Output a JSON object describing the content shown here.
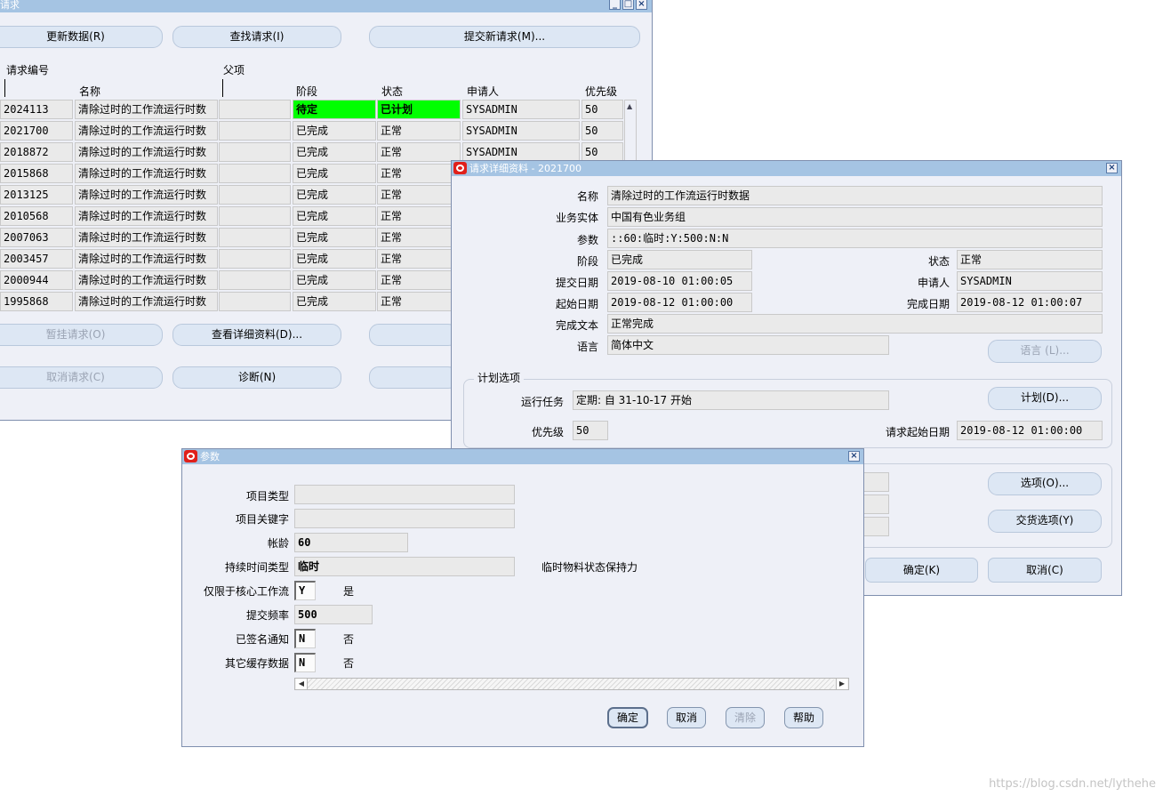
{
  "request_window": {
    "title": "请求",
    "buttons": {
      "refresh": "更新数据(R)",
      "find": "查找请求(I)",
      "submit_new": "提交新请求(M)...",
      "hold": "暂挂请求(O)",
      "view_details": "查看详细资料(D)...",
      "cancel_request": "取消请求(C)",
      "diagnose": "诊断(N)"
    },
    "headers": {
      "request_id": "请求编号",
      "parent": "父项",
      "name": "名称",
      "phase": "阶段",
      "status": "状态",
      "requestor": "申请人",
      "priority": "优先级"
    },
    "rows": [
      {
        "id": "2024113",
        "name": "清除过时的工作流运行时数",
        "phase": "待定",
        "status": "已计划",
        "requestor": "SYSADMIN",
        "priority": "50"
      },
      {
        "id": "2021700",
        "name": "清除过时的工作流运行时数",
        "phase": "已完成",
        "status": "正常",
        "requestor": "SYSADMIN",
        "priority": "50"
      },
      {
        "id": "2018872",
        "name": "清除过时的工作流运行时数",
        "phase": "已完成",
        "status": "正常",
        "requestor": "SYSADMIN",
        "priority": "50"
      },
      {
        "id": "2015868",
        "name": "清除过时的工作流运行时数",
        "phase": "已完成",
        "status": "正常",
        "requestor": "",
        "priority": ""
      },
      {
        "id": "2013125",
        "name": "清除过时的工作流运行时数",
        "phase": "已完成",
        "status": "正常",
        "requestor": "",
        "priority": ""
      },
      {
        "id": "2010568",
        "name": "清除过时的工作流运行时数",
        "phase": "已完成",
        "status": "正常",
        "requestor": "",
        "priority": ""
      },
      {
        "id": "2007063",
        "name": "清除过时的工作流运行时数",
        "phase": "已完成",
        "status": "正常",
        "requestor": "",
        "priority": ""
      },
      {
        "id": "2003457",
        "name": "清除过时的工作流运行时数",
        "phase": "已完成",
        "status": "正常",
        "requestor": "",
        "priority": ""
      },
      {
        "id": "2000944",
        "name": "清除过时的工作流运行时数",
        "phase": "已完成",
        "status": "正常",
        "requestor": "",
        "priority": ""
      },
      {
        "id": "1995868",
        "name": "清除过时的工作流运行时数",
        "phase": "已完成",
        "status": "正常",
        "requestor": "",
        "priority": ""
      }
    ]
  },
  "detail_window": {
    "title": "请求详细资料 - 2021700",
    "labels": {
      "name": "名称",
      "org": "业务实体",
      "params": "参数",
      "phase": "阶段",
      "status": "状态",
      "submit_date": "提交日期",
      "requestor": "申请人",
      "start_date": "起始日期",
      "complete_date": "完成日期",
      "completion_text": "完成文本",
      "language": "语言",
      "schedule_group": "计划选项",
      "run_job": "运行任务",
      "priority": "优先级",
      "req_start_date": "请求起始日期"
    },
    "values": {
      "name": "清除过时的工作流运行时数据",
      "org": "中国有色业务组",
      "params": "::60:临时:Y:500:N:N",
      "phase": "已完成",
      "status": "正常",
      "submit_date": "2019-08-10 01:00:05",
      "requestor": "SYSADMIN",
      "start_date": "2019-08-12 01:00:00",
      "complete_date": "2019-08-12 01:00:07",
      "completion_text": "正常完成",
      "language": "简体中文",
      "run_job": "定期: 自 31-10-17 开始",
      "priority": "50",
      "req_start_date": "2019-08-12 01:00:00"
    },
    "buttons": {
      "language": "语言 (L)...",
      "schedule": "计划(D)...",
      "options": "选项(O)...",
      "delivery": "交货选项(Y)",
      "ok": "确定(K)",
      "cancel": "取消(C)"
    }
  },
  "params_window": {
    "title": "参数",
    "fields": [
      {
        "label": "项目类型",
        "value": "",
        "desc": ""
      },
      {
        "label": "项目关键字",
        "value": "",
        "desc": ""
      },
      {
        "label": "帐龄",
        "value": "60",
        "desc": ""
      },
      {
        "label": "持续时间类型",
        "value": "临时",
        "desc": "临时物料状态保持力"
      },
      {
        "label": "仅限于核心工作流",
        "value": "Y",
        "desc": "是"
      },
      {
        "label": "提交频率",
        "value": "500",
        "desc": ""
      },
      {
        "label": "已签名通知",
        "value": "N",
        "desc": "否"
      },
      {
        "label": "其它缓存数据",
        "value": "N",
        "desc": "否"
      }
    ],
    "buttons": {
      "ok": "确定",
      "cancel": "取消",
      "clear": "清除",
      "help": "帮助"
    }
  },
  "watermark": "https://blog.csdn.net/lythehe",
  "colors": {
    "title_bar": "#a5c4e3",
    "window_bg": "#eef0f7",
    "highlight": "#00ff00",
    "oracle_red": "#e0201b"
  }
}
